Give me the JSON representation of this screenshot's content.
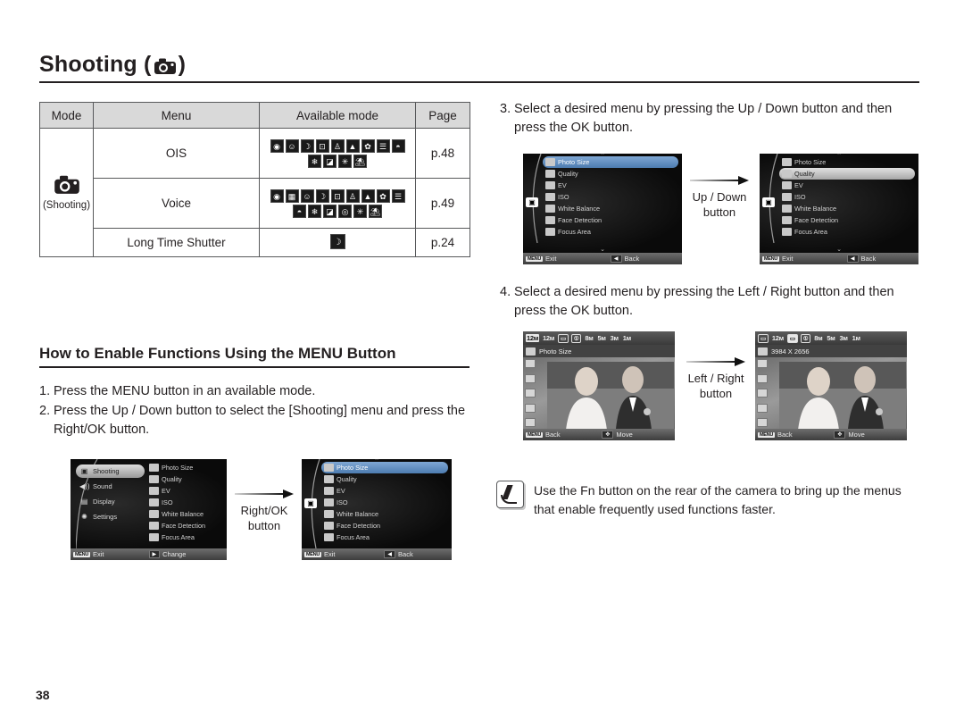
{
  "header": {
    "title_prefix": "Shooting (",
    "title_suffix": ")",
    "camera_icon": "camera-icon"
  },
  "mode_table": {
    "headers": [
      "Mode",
      "Menu",
      "Available mode",
      "Page"
    ],
    "mode_label": "(Shooting)",
    "rows": [
      {
        "menu": "OIS",
        "page": "p.48",
        "icons": [
          "auto",
          "portrait",
          "night",
          "frame",
          "child",
          "landscape",
          "close-up",
          "text",
          "sunset",
          "dawn",
          "backlight",
          "fireworks",
          "beach-snow"
        ]
      },
      {
        "menu": "Voice",
        "page": "p.49",
        "icons": [
          "auto",
          "movie",
          "portrait",
          "night",
          "frame",
          "child",
          "landscape",
          "close-up",
          "text",
          "sunset",
          "dawn",
          "backlight",
          "firework-circle",
          "fireworks",
          "beach-snow"
        ]
      },
      {
        "menu": "Long Time Shutter",
        "page": "p.24",
        "icons": [
          "night"
        ]
      }
    ]
  },
  "section": {
    "heading": "How to Enable Functions Using the MENU Button"
  },
  "steps_left": [
    {
      "num": "1.",
      "text": "Press the MENU button in an available mode."
    },
    {
      "num": "2.",
      "text": "Press the Up / Down button to select the [Shooting] menu and press the Right/OK button."
    }
  ],
  "steps_right": [
    {
      "num": "3.",
      "text": "Select a desired menu by pressing the Up / Down button and then press the OK button."
    },
    {
      "num": "4.",
      "text": "Select a desired menu by pressing the Left / Right button and then press the OK button."
    }
  ],
  "arrows": {
    "right_ok": {
      "line1": "Right/OK",
      "line2": "button"
    },
    "up_down": {
      "line1": "Up / Down",
      "line2": "button"
    },
    "left_right": {
      "line1": "Left / Right",
      "line2": "button"
    }
  },
  "lcd_main_menu": {
    "tabs": [
      {
        "label": "Shooting",
        "icon": "camera-icon",
        "selected": true
      },
      {
        "label": "Sound",
        "icon": "speaker-icon",
        "selected": false
      },
      {
        "label": "Display",
        "icon": "display-icon",
        "selected": false
      },
      {
        "label": "Settings",
        "icon": "gear-icon",
        "selected": false
      }
    ],
    "items": [
      {
        "label": "Photo Size",
        "icon": "photo-size-icon"
      },
      {
        "label": "Quality",
        "icon": "quality-icon"
      },
      {
        "label": "EV",
        "icon": "ev-icon"
      },
      {
        "label": "ISO",
        "icon": "iso-icon"
      },
      {
        "label": "White Balance",
        "icon": "white-balance-icon"
      },
      {
        "label": "Face Detection",
        "icon": "face-detection-icon"
      },
      {
        "label": "Focus Area",
        "icon": "focus-area-icon"
      }
    ],
    "bottom": {
      "menu_key": "MENU",
      "exit": "Exit",
      "dir_key": "▶",
      "action": "Change"
    }
  },
  "lcd_submenu": {
    "items": [
      {
        "label": "Photo Size",
        "icon": "photo-size-icon"
      },
      {
        "label": "Quality",
        "icon": "quality-icon"
      },
      {
        "label": "EV",
        "icon": "ev-icon"
      },
      {
        "label": "ISO",
        "icon": "iso-icon"
      },
      {
        "label": "White Balance",
        "icon": "white-balance-icon"
      },
      {
        "label": "Face Detection",
        "icon": "face-detection-icon"
      },
      {
        "label": "Focus Area",
        "icon": "focus-area-icon"
      }
    ],
    "selected_index_a": 0,
    "selected_index_b": 1,
    "bottom": {
      "menu_key": "MENU",
      "exit": "Exit",
      "dir_key": "◀",
      "action": "Back"
    }
  },
  "lcd_photo_size": {
    "resolutions": [
      "12ᴍ",
      "12ᴍ",
      "▭",
      "①",
      "8ᴍ",
      "5ᴍ",
      "3ᴍ",
      "1ᴍ"
    ],
    "selected_index_a": 0,
    "selected_index_b": 2,
    "label_a": "Photo Size",
    "label_b": "3984 X 2656",
    "bottom": {
      "menu_key": "MENU",
      "back": "Back",
      "dir_key": "✥",
      "action": "Move"
    }
  },
  "note": {
    "icon": "note-pen-icon",
    "text": "Use the Fn button on the rear of the camera to bring up the menus that enable frequently used functions faster."
  },
  "page_number": "38"
}
